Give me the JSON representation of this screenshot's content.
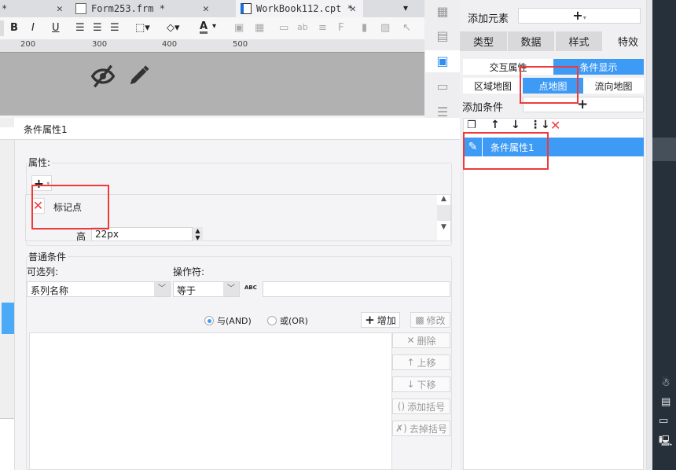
{
  "tabs": [
    {
      "label": "*"
    },
    {
      "label": "Form253.frm *"
    },
    {
      "label": "WorkBook112.cpt *",
      "active": true
    }
  ],
  "toolbar": {
    "bold": "B",
    "italic": "I",
    "underline": "U",
    "font_color": "A"
  },
  "ruler": [
    "200",
    "300",
    "400",
    "500"
  ],
  "dialog": {
    "title": "条件属性1",
    "attr_section": "属性:",
    "attr_item": "标记点",
    "height_label": "高",
    "height_value": "22px",
    "cond_section": "普通条件",
    "column_label": "可选列:",
    "column_value": "系列名称",
    "operator_label": "操作符:",
    "operator_value": "等于",
    "abc_icon": "ABC",
    "value_input": "",
    "and_label": "与(AND)",
    "or_label": "或(OR)",
    "add": "增加",
    "modify": "修改",
    "delete": "删除",
    "move_up": "上移",
    "move_down": "下移",
    "add_paren": "添加括号",
    "remove_paren": "去掉括号"
  },
  "right_panel": {
    "add_element": "添加元素",
    "tabs": [
      "类型",
      "数据",
      "样式",
      "特效"
    ],
    "sub_tabs": [
      "交互属性",
      "条件显示"
    ],
    "map_tabs": [
      "区域地图",
      "点地图",
      "流向地图"
    ],
    "add_condition": "添加条件",
    "conditions": [
      "条件属性1"
    ]
  },
  "colors": {
    "accent": "#3e9bf5",
    "highlight": "#f03a3a"
  }
}
